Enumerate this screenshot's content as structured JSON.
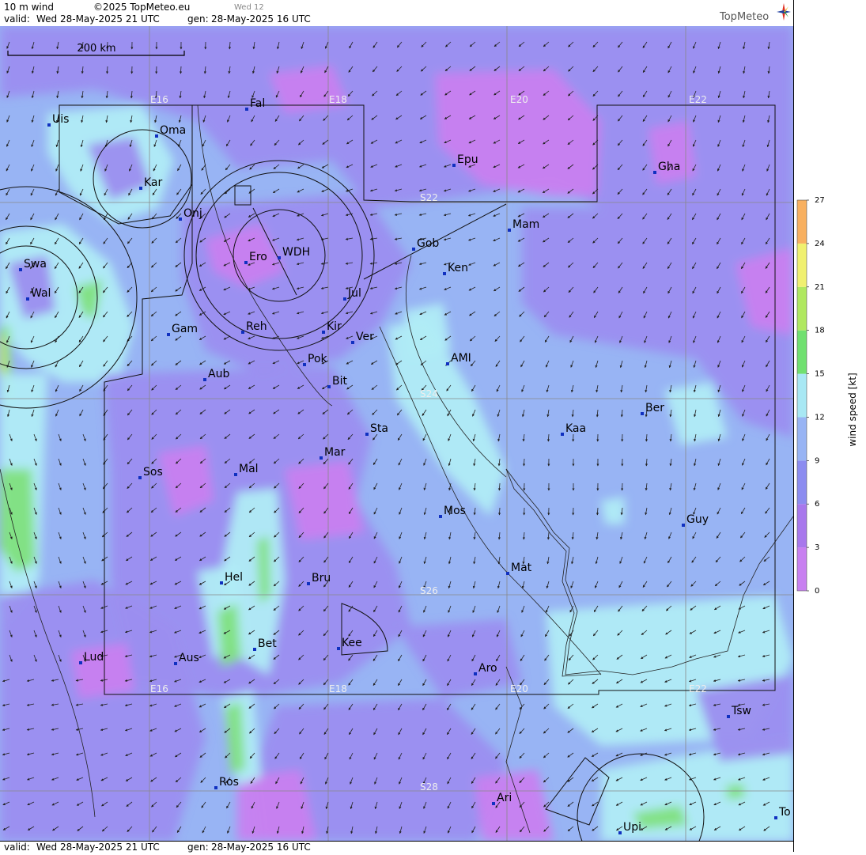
{
  "header": {
    "field": "10 m wind",
    "copyright": "©2025 TopMeteo.eu",
    "step": "Wed 12",
    "valid_label": "valid:",
    "valid_time": "Wed  28-May-2025  21 UTC",
    "gen_label": "gen:",
    "gen_time": "28-May-2025 16 UTC",
    "logo": "TopMeteo"
  },
  "footer": {
    "valid_label": "valid:",
    "valid_time": "Wed  28-May-2025  21 UTC",
    "gen_label": "gen:",
    "gen_time": "28-May-2025 16 UTC"
  },
  "scale_bar": {
    "label": "200 km"
  },
  "grid": {
    "longitudes": [
      "E16",
      "E18",
      "E20",
      "E22"
    ],
    "latitudes": [
      "S22",
      "S24",
      "S26",
      "S28"
    ]
  },
  "places": [
    "Uis",
    "Oma",
    "Fal",
    "Kar",
    "Onj",
    "Epu",
    "Gha",
    "Mam",
    "Gob",
    "WDH",
    "Ero",
    "Ken",
    "Swa",
    "Wal",
    "Jul",
    "Gam",
    "Reh",
    "Kir",
    "Ver",
    "AMI",
    "Pok",
    "Bit",
    "Aub",
    "Ber",
    "Sta",
    "Kaa",
    "Mar",
    "Sos",
    "Mal",
    "Mos",
    "Guy",
    "Mat",
    "Hel",
    "Bru",
    "Bet",
    "Kee",
    "Lud",
    "Aus",
    "Aro",
    "Tsw",
    "Ros",
    "Ari",
    "To",
    "Upi"
  ],
  "colorbar": {
    "title": "wind speed [kt]",
    "ticks": [
      "0",
      "3",
      "6",
      "9",
      "12",
      "15",
      "18",
      "21",
      "24",
      "27"
    ],
    "colors": [
      "#c880f0",
      "#a878ec",
      "#8c8cf0",
      "#98b4f4",
      "#a8e8f4",
      "#70e070",
      "#b0e860",
      "#f0f070",
      "#f8b060",
      "#f07060"
    ]
  },
  "map_colors": {
    "low": "#c880f0",
    "violet": "#9b8ef0",
    "blue": "#98b4f4",
    "light": "#b0ecf6",
    "green": "#80e080",
    "yellow_green": "#c8ec60"
  }
}
